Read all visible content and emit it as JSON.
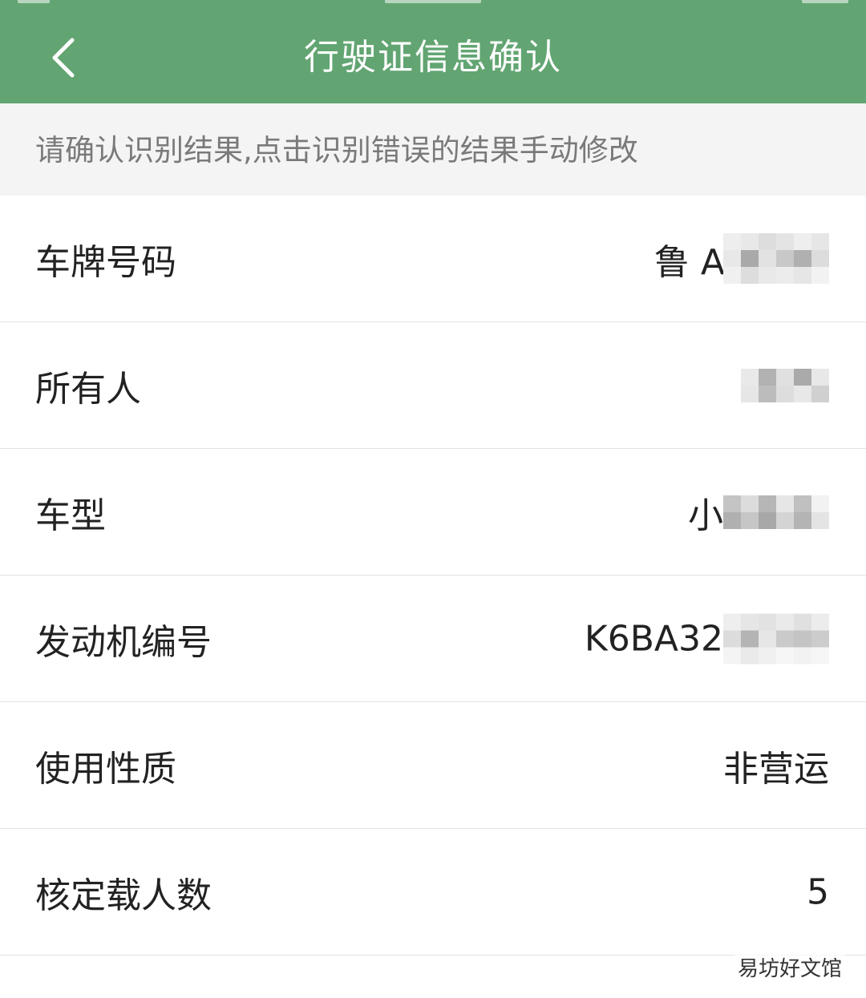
{
  "header": {
    "title": "行驶证信息确认",
    "back_icon": "chevron-left-icon",
    "background": "#62a572"
  },
  "hint": {
    "text": "请确认识别结果,点击识别错误的结果手动修改"
  },
  "rows": [
    {
      "label": "车牌号码",
      "value": "鲁 A",
      "redacted": true
    },
    {
      "label": "所有人",
      "value": "",
      "redacted": true
    },
    {
      "label": "车型",
      "value": "小",
      "redacted": true
    },
    {
      "label": "发动机编号",
      "value": "K6BA32",
      "redacted": true
    },
    {
      "label": "使用性质",
      "value": "非营运",
      "redacted": false
    },
    {
      "label": "核定载人数",
      "value": "5",
      "redacted": false
    }
  ],
  "watermark": "易坊好文馆"
}
